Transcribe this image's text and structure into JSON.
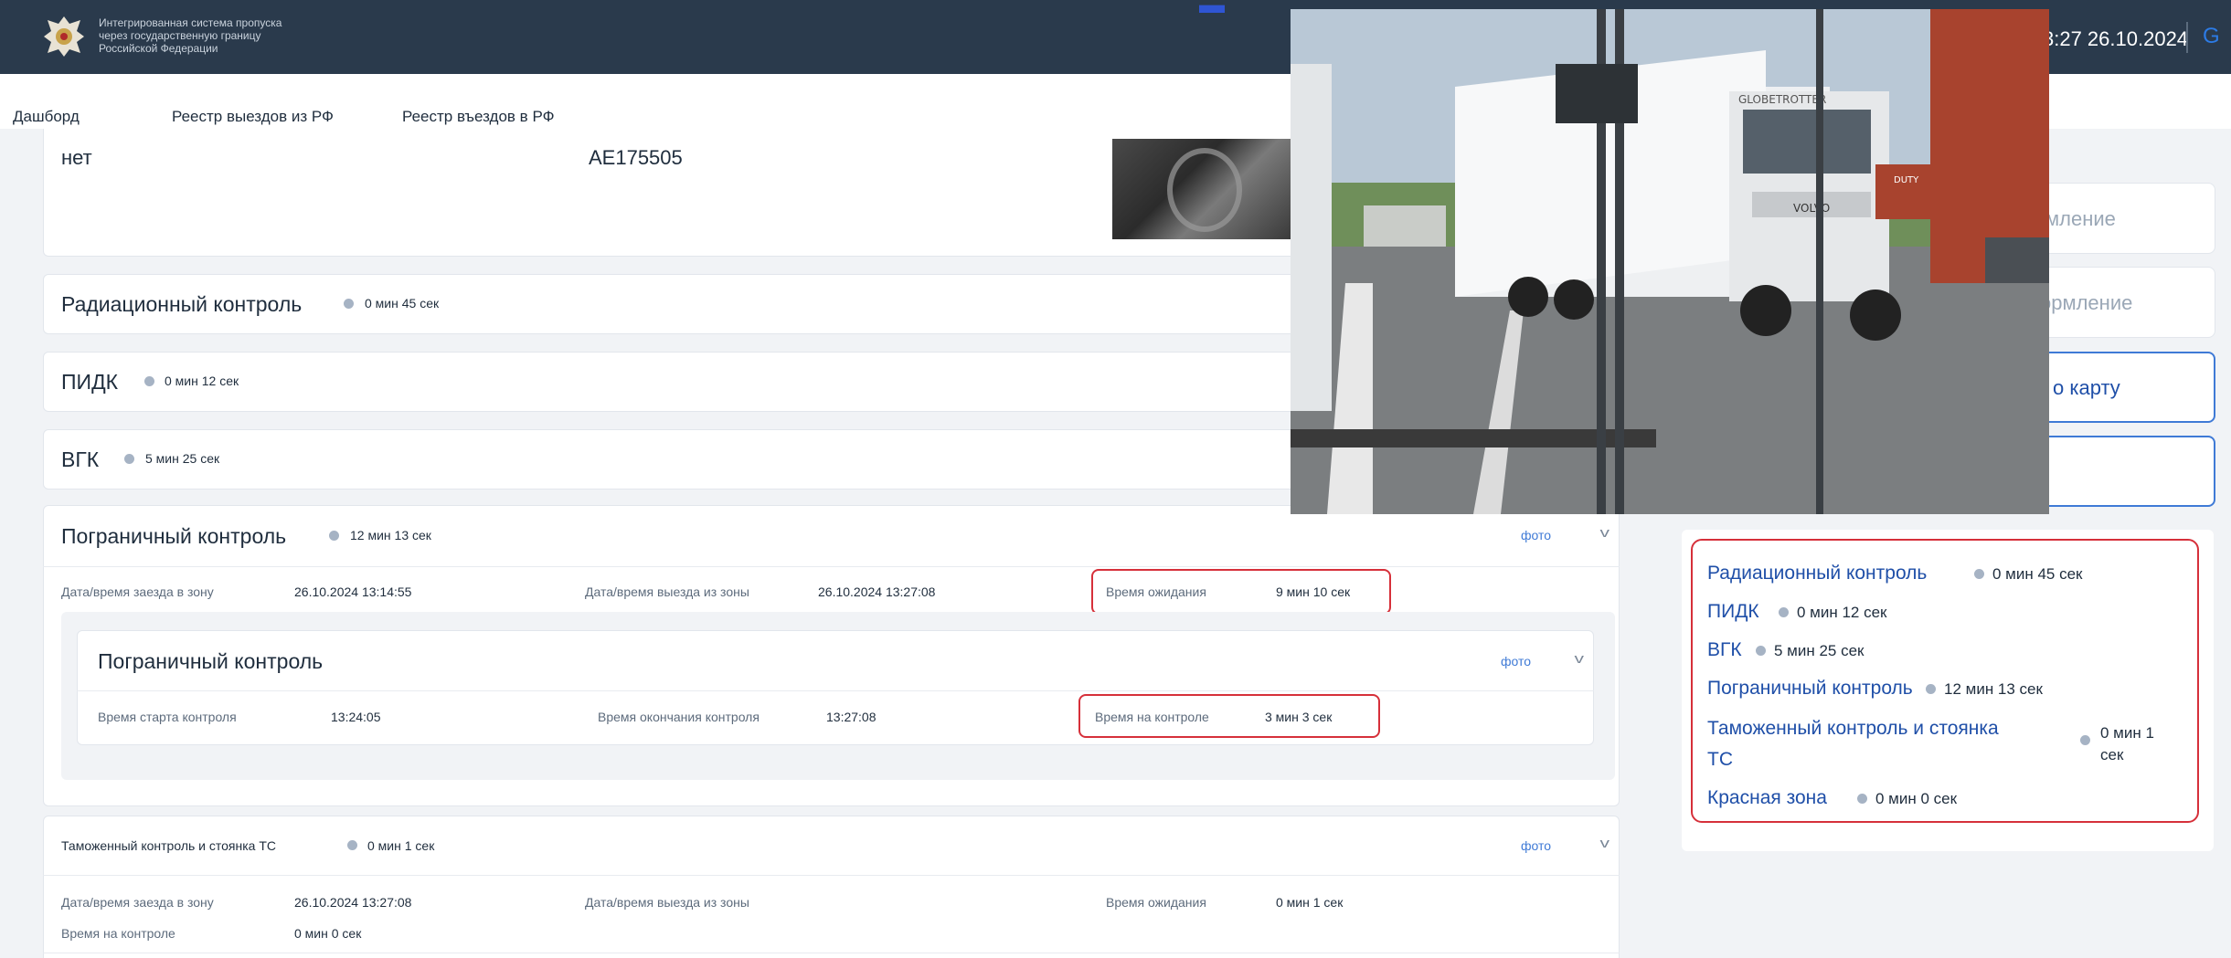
{
  "header": {
    "org_lines": [
      "Интегрированная система пропуска",
      "через государственную границу",
      "Российской Федерации"
    ],
    "time_partial": "3:27 26.10.2024",
    "right_glyph": "G"
  },
  "nav": {
    "items": [
      "Дашборд",
      "Реестр выездов из РФ",
      "Реестр въездов в РФ"
    ]
  },
  "top_card": {
    "left_text": "нет",
    "mid_text": "АЕ175505"
  },
  "sections": {
    "radiation": {
      "title": "Радиационный контроль",
      "duration": "0 мин 45 сек"
    },
    "pidk": {
      "title": "ПИДК",
      "duration": "0 мин 12 сек"
    },
    "vgk": {
      "title": "ВГК",
      "duration": "5 мин 25 сек"
    },
    "border": {
      "title": "Пограничный контроль",
      "duration": "12 мин 13 сек",
      "foto": "фото",
      "entry_label": "Дата/время заезда в зону",
      "entry_value": "26.10.2024 13:14:55",
      "exit_label": "Дата/время выезда из зоны",
      "exit_value": "26.10.2024 13:27:08",
      "wait_label": "Время ожидания",
      "wait_value": "9 мин 10 сек",
      "inner": {
        "title": "Пограничный контроль",
        "foto": "фото",
        "start_label": "Время старта контроля",
        "start_value": "13:24:05",
        "end_label": "Время окончания контроля",
        "end_value": "13:27:08",
        "on_control_label": "Время на контроле",
        "on_control_value": "3 мин 3 сек"
      }
    },
    "customs": {
      "title": "Таможенный контроль и стоянка ТС",
      "duration": "0 мин 1 сек",
      "foto": "фото",
      "entry_label": "Дата/время заезда в зону",
      "entry_value": "26.10.2024 13:27:08",
      "exit_label": "Дата/время выезда из зоны",
      "wait_label": "Время ожидания",
      "wait_value": "0 мин 1 сек",
      "control_label": "Время на контроле",
      "control_value": "0 мин 0 сек"
    }
  },
  "right_panel": {
    "btn1": "мление",
    "btn2": "ормление",
    "btn3": "о карту",
    "summary": [
      {
        "label": "Радиационный контроль",
        "duration": "0 мин 45 сек"
      },
      {
        "label": "ПИДК",
        "duration": "0 мин 12 сек"
      },
      {
        "label": "ВГК",
        "duration": "5 мин 25 сек"
      },
      {
        "label": "Пограничный контроль",
        "duration": "12 мин 13 сек"
      },
      {
        "label": "Таможенный контроль и стоянка",
        "label_line2": "ТС",
        "duration": "0 мин 1",
        "duration_line2": "сек"
      },
      {
        "label": "Красная зона",
        "duration": "0 мин 0 сек"
      }
    ]
  },
  "photo": {
    "truck_brand": "VOLVO",
    "trailer_text": "GLOBETROTTER",
    "sign_text": "DUTY"
  },
  "colors": {
    "header_bg": "#2a3a4c",
    "highlight_red": "#d6303a",
    "link_blue": "#3f7ad6"
  }
}
